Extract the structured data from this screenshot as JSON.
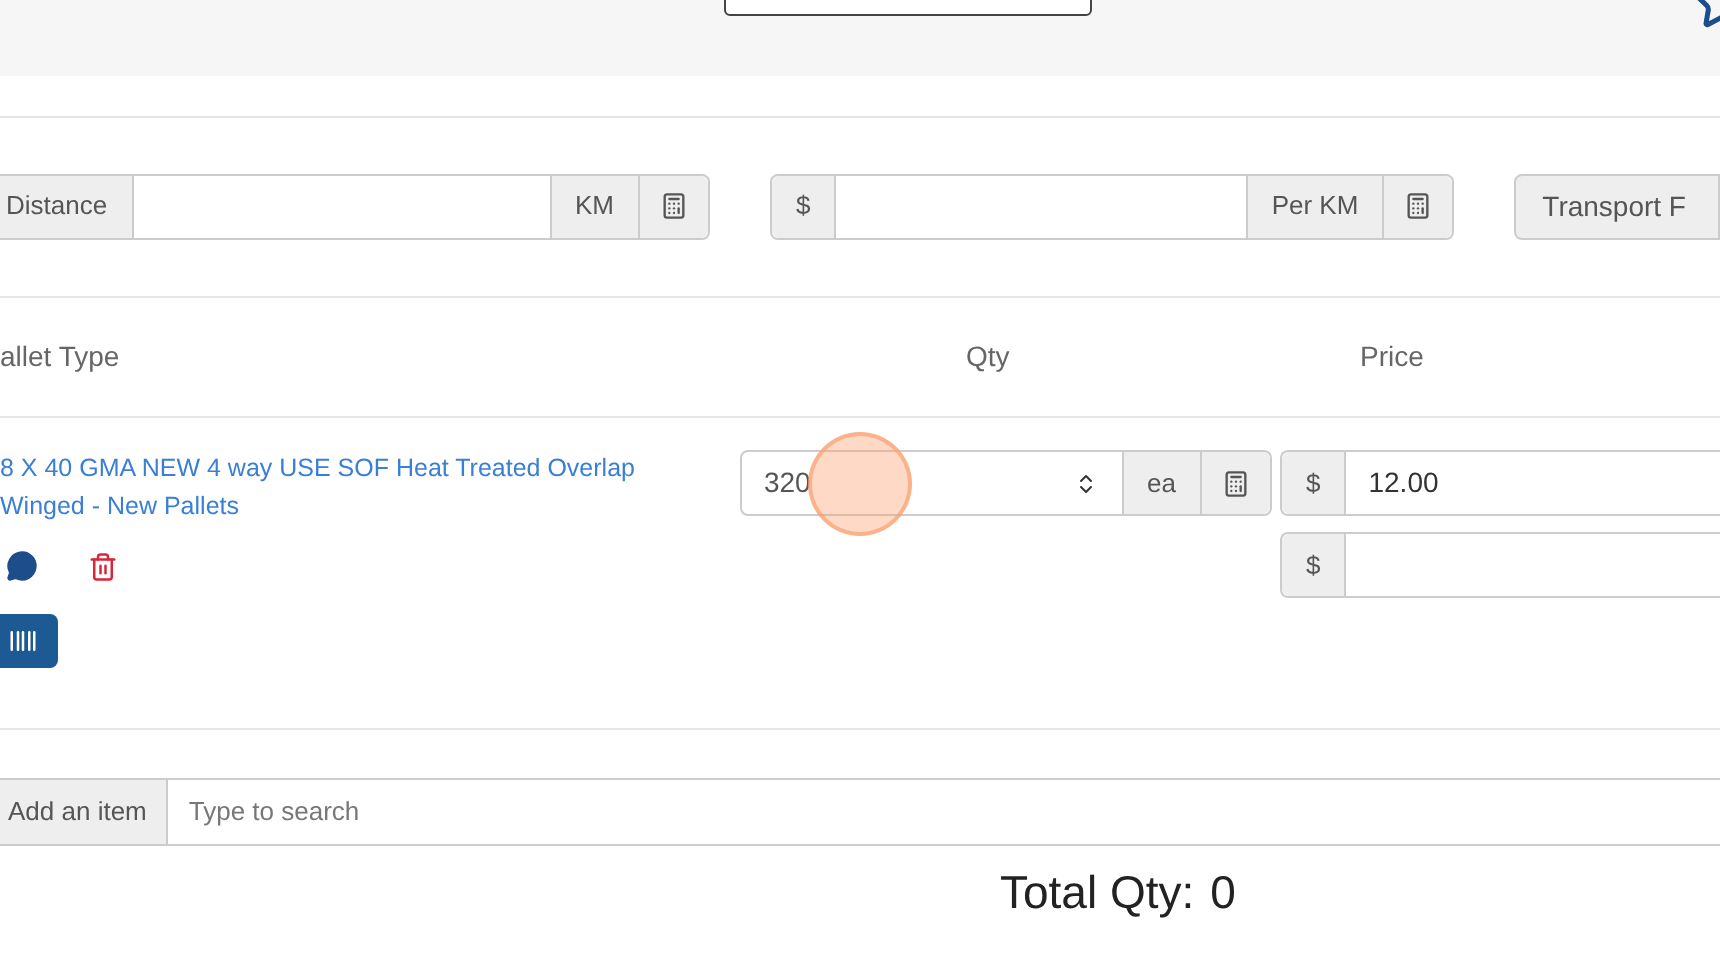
{
  "transport": {
    "distance_label": "Distance",
    "distance_unit": "KM",
    "rate_prefix": "$",
    "rate_unit": "Per KM",
    "fee_label": "Transport F"
  },
  "table": {
    "columns": [
      "allet Type",
      "Qty",
      "Price"
    ],
    "rows": [
      {
        "name": "8 X 40 GMA NEW 4 way USE SOF Heat Treated Overlap Winged - New Pallets",
        "qty": "320",
        "unit": "ea",
        "prices": [
          {
            "prefix": "$",
            "value": "12.00"
          },
          {
            "prefix": "$"
          }
        ]
      }
    ]
  },
  "add_item": {
    "label": "Add an item",
    "placeholder": "Type to search"
  },
  "total": {
    "label": "Total Qty:",
    "value": "0"
  }
}
